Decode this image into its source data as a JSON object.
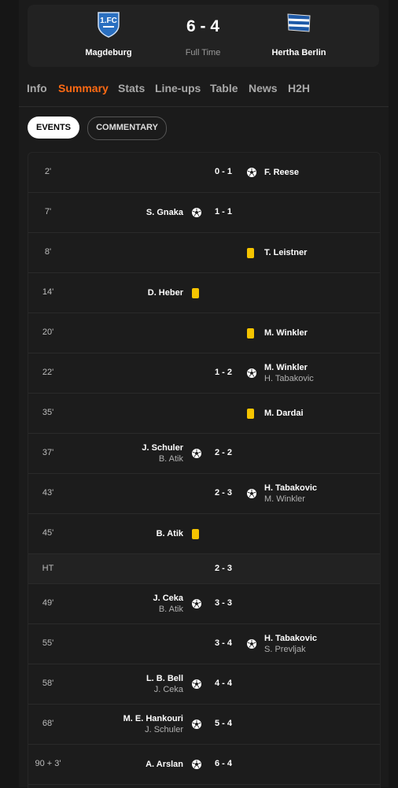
{
  "match": {
    "home": {
      "name": "Magdeburg",
      "logo": "magdeburg-crest-icon"
    },
    "away": {
      "name": "Hertha Berlin",
      "logo": "hertha-flag-icon"
    },
    "score": "6 - 4",
    "status": "Full Time"
  },
  "tabs": [
    "Info",
    "Summary",
    "Stats",
    "Line-ups",
    "Table",
    "News",
    "H2H"
  ],
  "active_tab": "Summary",
  "toggle": {
    "events": "EVENTS",
    "commentary": "COMMENTARY",
    "active": "EVENTS"
  },
  "colors": {
    "accent": "#ff6a13",
    "yellow_card": "#f5c400",
    "background": "#161616"
  },
  "events": [
    {
      "minute": "2'",
      "side": "away",
      "type": "goal",
      "player": "F. Reese",
      "assist": "",
      "score": "0 - 1"
    },
    {
      "minute": "7'",
      "side": "home",
      "type": "goal",
      "player": "S. Gnaka",
      "assist": "",
      "score": "1 - 1"
    },
    {
      "minute": "8'",
      "side": "away",
      "type": "yellow",
      "player": "T. Leistner",
      "assist": "",
      "score": ""
    },
    {
      "minute": "14'",
      "side": "home",
      "type": "yellow",
      "player": "D. Heber",
      "assist": "",
      "score": ""
    },
    {
      "minute": "20'",
      "side": "away",
      "type": "yellow",
      "player": "M. Winkler",
      "assist": "",
      "score": ""
    },
    {
      "minute": "22'",
      "side": "away",
      "type": "goal",
      "player": "M. Winkler",
      "assist": "H. Tabakovic",
      "score": "1 - 2"
    },
    {
      "minute": "35'",
      "side": "away",
      "type": "yellow",
      "player": "M. Dardai",
      "assist": "",
      "score": ""
    },
    {
      "minute": "37'",
      "side": "home",
      "type": "goal",
      "player": "J. Schuler",
      "assist": "B. Atik",
      "score": "2 - 2"
    },
    {
      "minute": "43'",
      "side": "away",
      "type": "goal",
      "player": "H. Tabakovic",
      "assist": "M. Winkler",
      "score": "2 - 3"
    },
    {
      "minute": "45'",
      "side": "home",
      "type": "yellow",
      "player": "B. Atik",
      "assist": "",
      "score": ""
    },
    {
      "minute": "HT",
      "side": "",
      "type": "ht",
      "player": "",
      "assist": "",
      "score": "2 - 3"
    },
    {
      "minute": "49'",
      "side": "home",
      "type": "goal",
      "player": "J. Ceka",
      "assist": "B. Atik",
      "score": "3 - 3"
    },
    {
      "minute": "55'",
      "side": "away",
      "type": "goal",
      "player": "H. Tabakovic",
      "assist": "S. Prevljak",
      "score": "3 - 4"
    },
    {
      "minute": "58'",
      "side": "home",
      "type": "goal",
      "player": "L. B. Bell",
      "assist": "J. Ceka",
      "score": "4 - 4"
    },
    {
      "minute": "68'",
      "side": "home",
      "type": "goal",
      "player": "M. E. Hankouri",
      "assist": "J. Schuler",
      "score": "5 - 4"
    },
    {
      "minute": "90 + 3'",
      "side": "home",
      "type": "goal",
      "player": "A. Arslan",
      "assist": "",
      "score": "6 - 4"
    }
  ]
}
